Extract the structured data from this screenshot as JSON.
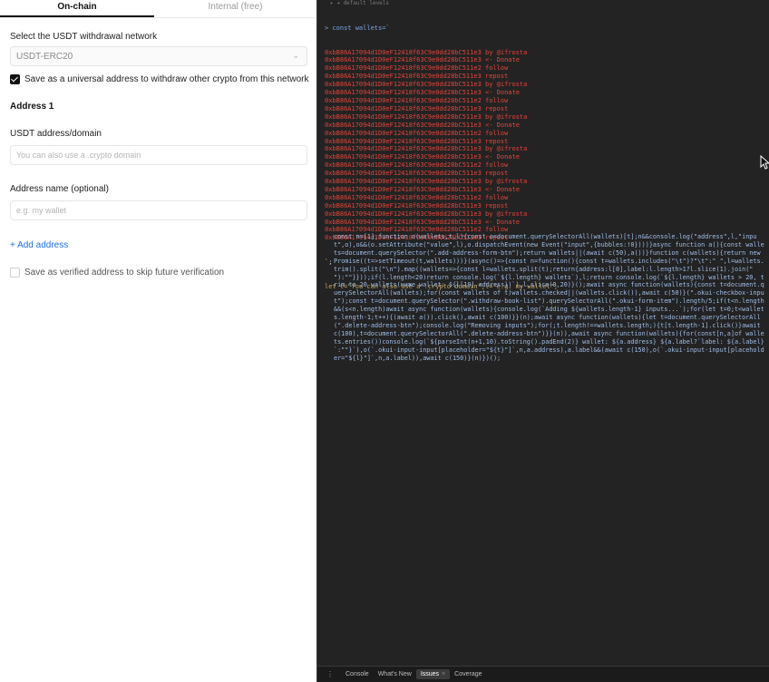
{
  "tabs": {
    "onchain": "On-chain",
    "internal": "Internal (free)"
  },
  "network": {
    "label": "Select the USDT withdrawal network",
    "selected": "USDT-ERC20"
  },
  "universal": {
    "label": "Save as a universal address to withdraw other crypto from this network",
    "checked": true
  },
  "address": {
    "heading": "Address 1",
    "field_label": "USDT address/domain",
    "field_placeholder": "You can also use a .crypto domain",
    "name_label": "Address name (optional)",
    "name_placeholder": "e.g. my wallet"
  },
  "add_address": "+ Add address",
  "verified": {
    "label": "Save as verified address to skip future verification",
    "checked": false
  },
  "devtools": {
    "header": "▸ ◂ default levels",
    "prompt_line": "> const wallets=`",
    "log_lines": [
      "0xbB86A17094d1D0eF12418f63C9e0dd28bC511e3 by @ifrosta",
      "0xbB86A17094d1D0eF12418f63C9e0dd28bC511e3 <- Donate",
      "0xbB86A17094d1D0eF12418f63C9e0dd28bC511e2 follow",
      "0xbB86A17094d1D0eF12418f63C9e0dd28bC511e3 repost",
      "0xbB86A17094d1D0eF12418f63C9e0dd28bC511e3 by @ifrosta",
      "0xbB86A17094d1D0eF12418f63C9e0dd28bC511e3 <- Donate",
      "0xbB86A17094d1D0eF12418f63C9e0dd28bC511e2 follow",
      "0xbB86A17094d1D0eF12418f63C9e0dd28bC511e3 repost",
      "0xbB86A17094d1D0eF12418f63C9e0dd28bC511e3 by @ifrosta",
      "0xbB86A17094d1D0eF12418f63C9e0dd28bC511e3 <- Donate",
      "0xbB86A17094d1D0eF12418f63C9e0dd28bC511e2 follow",
      "0xbB86A17094d1D0eF12418f63C9e0dd28bC511e3 repost",
      "0xbB86A17094d1D0eF12418f63C9e0dd28bC511e3 by @ifrosta",
      "0xbB86A17094d1D0eF12418f63C9e0dd28bC511e3 <- Donate",
      "0xbB86A17094d1D0eF12418f63C9e0dd28bC511e2 follow",
      "0xbB86A17094d1D0eF12418f63C9e0dd28bC511e3 repost",
      "0xbB86A17094d1D0eF12418f63C9e0dd28bC511e3 by @ifrosta",
      "0xbB86A17094d1D0eF12418f63C9e0dd28bC511e3 <- Donate",
      "0xbB86A17094d1D0eF12418f63C9e0dd28bC511e2 follow",
      "0xbB86A17094d1D0eF12418f63C9e0dd28bC511e3 repost",
      "0xbB86A17094d1D0eF12418f63C9e0dd28bC511e3 by @ifrosta",
      "0xbB86A17094d1D0eF12418f63C9e0dd28bC511e3 <- Donate",
      "0xbB86A17094d1D0eF12418f63C9e0dd28bC511e2 follow",
      "0xbB86A17094d1D0eF12418f63C9e0dd28bC511e3 repost"
    ],
    "closing_line": "`;",
    "string_line": "let t=\"You can also use a .crypto domain\",l=\"e.g. my wallet\";",
    "code": "const n=[1];function o(wallets,t,l){const o=document.querySelectorAll(wallets)[t];n&&console.log(\"address\",l,\"input\",o),o&&(o.setAttribute(\"value\",l),o.dispatchEvent(new Event(\"input\",{bubbles:!0})))}async function a(){const wallets=document.querySelector(\".add-address-form-btn\");return wallets||(await c(50),a())}function c(wallets){return new Promise((t=>setTimeout(t,wallets)))}(async()=>{const n=function(){const t=wallets.includes(\"\\t\")?\"\\t\":\" \",l=wallets.trim().split(\"\\n\").map((wallets=>{const l=wallets.split(t);return{address:l[0],label:l.length>1?l.slice(1).join(\" \"):\"\"}}));if(l.length<20)return console.log(`${l.length} wallets`),l;return console.log(`${l.length} wallets > 20, trim to 20 wallets(ниже wallet: ${l[19].address})`),l.slice(0,20)}();await async function(wallets){const t=document.querySelectorAll(wallets);for(const wallets of t)wallets.checked||(wallets.click()),await c(50)}(\".okui-checkbox-input\");const t=document.querySelector(\".withdraw-book-list\").querySelectorAll(\".okui-form-item\").length/5;if(t<n.length&&(s<n.length)await async function(wallets){console.log(`Adding ${wallets.length-1} inputs...`);for(let t=0;t<wallets.length-1;t++){(await a()).click(),await c(100)}}(n);await async function(wallets){let t=document.querySelectorAll(\".delete-address-btn\");console.log(\"Removing inputs\");for(;t.length!==wallets.length;){t[t.length-1].click()}await c(100),t=document.querySelectorAll(\".delete-address-btn\")}}(n)),await async function(wallets){for(const[n,a]of wallets.entries())console.log(`${parseInt(n+1,10).toString().padEnd(2)} wallet: ${a.address} ${a.label?`label: ${a.label}`:\"\"}`),o(`.okui-input-input[placeholder=\"${t}\"]`,n,a.address),a.label&&(await c(150),o(`.okui-input-input[placeholder=\"${l}\"]`,n,a.label)),await c(150)}(n)})();",
    "drawer_tabs": [
      "Console",
      "What's New",
      "Issues",
      "Coverage"
    ],
    "drawer_active": "Issues"
  },
  "colors": {
    "error_text": "#e2453b",
    "link": "#1f6fe0",
    "devtools_bg": "#232323"
  }
}
